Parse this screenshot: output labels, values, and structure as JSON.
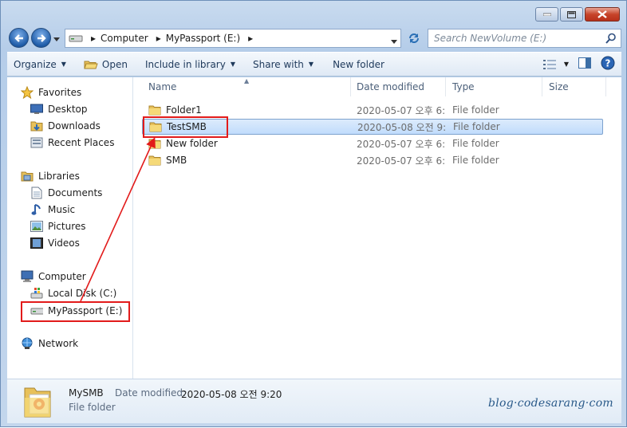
{
  "address": {
    "crumbs": [
      "Computer",
      "MyPassport  (E:)"
    ]
  },
  "search": {
    "placeholder": "Search NewVolume (E:)"
  },
  "toolbar": {
    "organize": "Organize",
    "open": "Open",
    "include_in_library": "Include in library",
    "share_with": "Share with",
    "new_folder": "New folder"
  },
  "nav": {
    "favorites": "Favorites",
    "desktop": "Desktop",
    "downloads": "Downloads",
    "recent_places": "Recent Places",
    "libraries": "Libraries",
    "documents": "Documents",
    "music": "Music",
    "pictures": "Pictures",
    "videos": "Videos",
    "computer": "Computer",
    "local_disk": "Local Disk (C:)",
    "mypassport": "MyPassport  (E:)",
    "network": "Network"
  },
  "columns": {
    "name": "Name",
    "date_modified": "Date modified",
    "type": "Type",
    "size": "Size"
  },
  "files": [
    {
      "name": "Folder1",
      "date": "2020-05-07 오후 6:...",
      "type": "File folder"
    },
    {
      "name": "TestSMB",
      "date": "2020-05-08 오전 9:...",
      "type": "File folder"
    },
    {
      "name": "New folder",
      "date": "2020-05-07 오후 6:...",
      "type": "File folder"
    },
    {
      "name": "SMB",
      "date": "2020-05-07 오후 6:...",
      "type": "File folder"
    }
  ],
  "details": {
    "name": "MySMB",
    "date_label": "Date modified:",
    "date_value": "2020-05-08 오전 9:20",
    "type": "File folder"
  },
  "watermark": "blog·codesarang·com",
  "colors": {
    "highlight": "#e21b1b",
    "selection": "#c1dcfc",
    "folder": "#e8c15a"
  }
}
